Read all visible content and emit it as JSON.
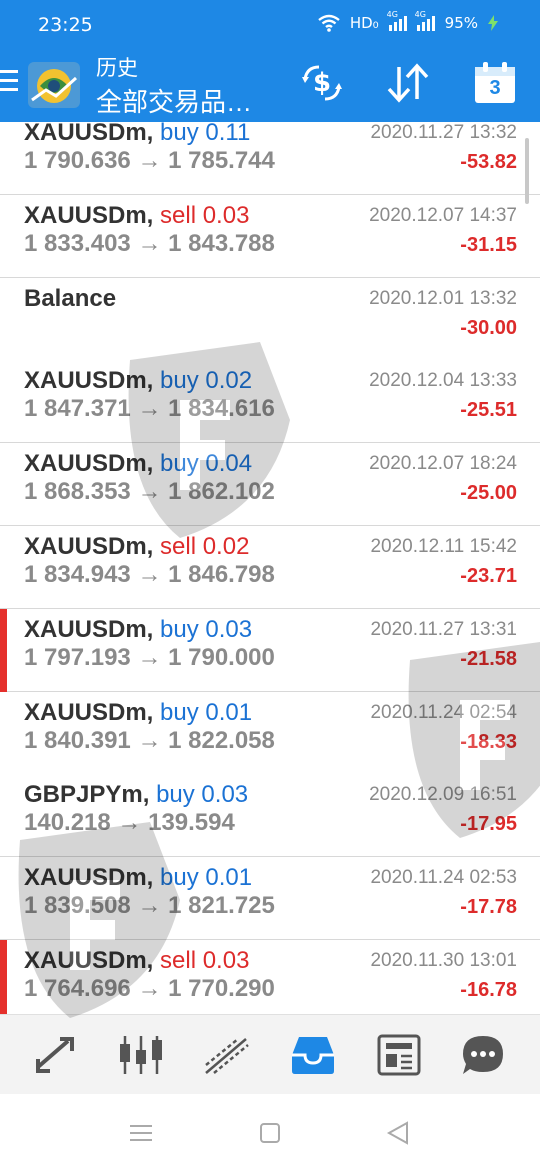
{
  "status_bar": {
    "time": "23:25",
    "network_label": "HD₀",
    "signal1_tag": "4G",
    "signal2_tag": "4G",
    "battery": "95%"
  },
  "header": {
    "title_top": "历史",
    "title_main": "全部交易品…",
    "calendar_day": "3"
  },
  "colors": {
    "header_bg": "#1e88e5",
    "buy": "#1b72d4",
    "sell": "#dd2b2b",
    "loss": "#dd2b2b",
    "marker": "#e5302c",
    "active_nav": "#1e88e5"
  },
  "history": [
    {
      "symbol": "XAUUSDm,",
      "side": "buy",
      "lots": "buy 0.11",
      "prices": "1 790.636 → 1 785.744",
      "date": "2020.11.27 13:32",
      "profit": "-53.82",
      "marked": false
    },
    {
      "symbol": "XAUUSDm,",
      "side": "sell",
      "lots": "sell 0.03",
      "prices": "1 833.403 → 1 843.788",
      "date": "2020.12.07 14:37",
      "profit": "-31.15",
      "marked": false
    },
    {
      "symbol": "Balance",
      "side": "",
      "lots": "",
      "prices": "",
      "date": "2020.12.01 13:32",
      "profit": "-30.00",
      "marked": false
    },
    {
      "symbol": "XAUUSDm,",
      "side": "buy",
      "lots": "buy 0.02",
      "prices": "1 847.371 → 1 834.616",
      "date": "2020.12.04 13:33",
      "profit": "-25.51",
      "marked": false
    },
    {
      "symbol": "XAUUSDm,",
      "side": "buy",
      "lots": "buy 0.04",
      "prices": "1 868.353 → 1 862.102",
      "date": "2020.12.07 18:24",
      "profit": "-25.00",
      "marked": false
    },
    {
      "symbol": "XAUUSDm,",
      "side": "sell",
      "lots": "sell 0.02",
      "prices": "1 834.943 → 1 846.798",
      "date": "2020.12.11 15:42",
      "profit": "-23.71",
      "marked": false
    },
    {
      "symbol": "XAUUSDm,",
      "side": "buy",
      "lots": "buy 0.03",
      "prices": "1 797.193 → 1 790.000",
      "date": "2020.11.27 13:31",
      "profit": "-21.58",
      "marked": true
    },
    {
      "symbol": "XAUUSDm,",
      "side": "buy",
      "lots": "buy 0.01",
      "prices": "1 840.391 → 1 822.058",
      "date": "2020.11.24 02:54",
      "profit": "-18.33",
      "marked": false
    },
    {
      "symbol": "GBPJPYm,",
      "side": "buy",
      "lots": "buy 0.03",
      "prices": "140.218 → 139.594",
      "date": "2020.12.09 16:51",
      "profit": "-17.95",
      "marked": false
    },
    {
      "symbol": "XAUUSDm,",
      "side": "buy",
      "lots": "buy 0.01",
      "prices": "1 839.508 → 1 821.725",
      "date": "2020.11.24 02:53",
      "profit": "-17.78",
      "marked": false
    },
    {
      "symbol": "XAUUSDm,",
      "side": "sell",
      "lots": "sell 0.03",
      "prices": "1 764.696 → 1 770.290",
      "date": "2020.11.30 13:01",
      "profit": "-16.78",
      "marked": true
    }
  ],
  "bottom_nav": [
    {
      "icon": "quotes-icon",
      "active": false
    },
    {
      "icon": "chart-icon",
      "active": false
    },
    {
      "icon": "trade-icon",
      "active": false
    },
    {
      "icon": "history-icon",
      "active": true
    },
    {
      "icon": "news-icon",
      "active": false
    },
    {
      "icon": "chat-icon",
      "active": false
    }
  ]
}
